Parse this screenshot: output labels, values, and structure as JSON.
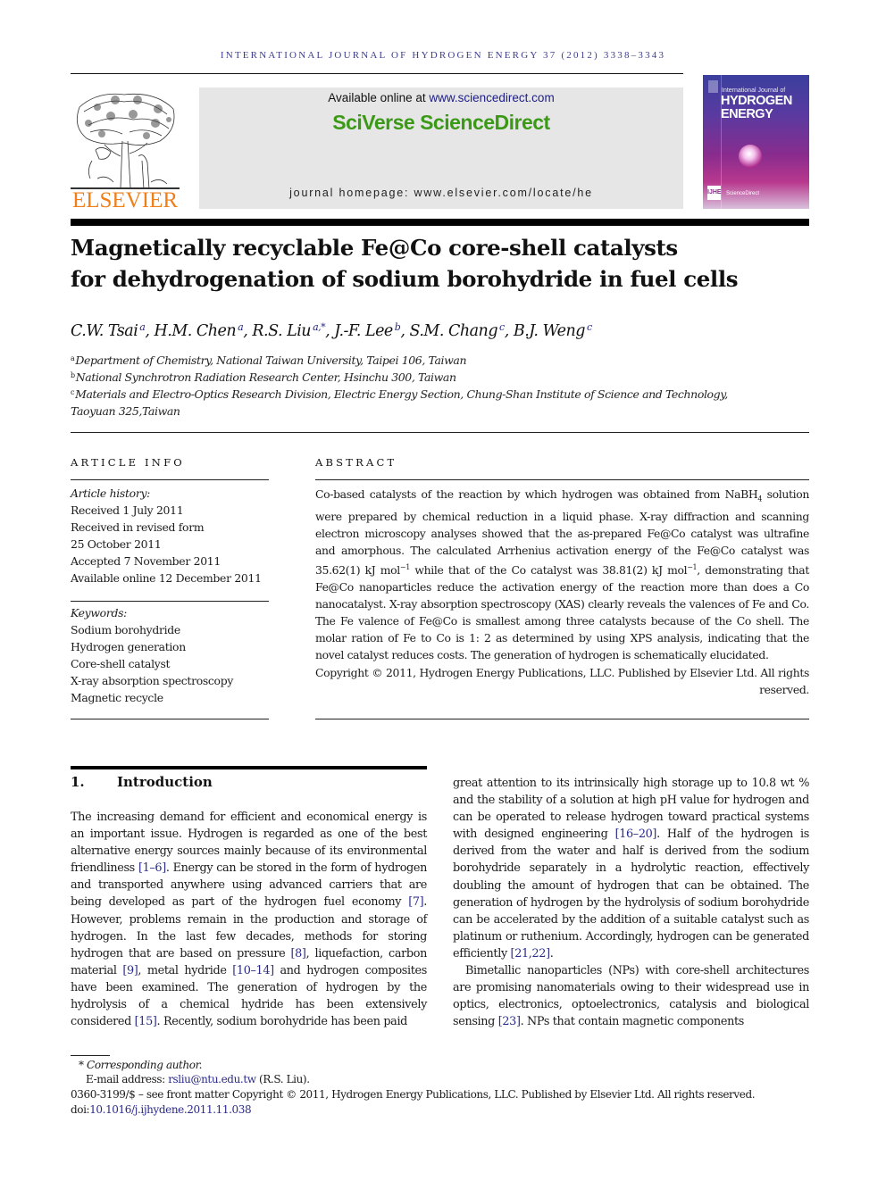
{
  "running_header": "INTERNATIONAL JOURNAL OF HYDROGEN ENERGY 37 (2012) 3338–3343",
  "publisher": {
    "logo_word": "ELSEVIER",
    "logo_color": "#f07f1a"
  },
  "banner": {
    "available_prefix": "Available online at ",
    "available_link": "www.sciencedirect.com",
    "brand": "SciVerse ScienceDirect",
    "brand_color": "#3a9a16",
    "homepage": "journal homepage: www.elsevier.com/locate/he"
  },
  "cover": {
    "line1": "International Journal of",
    "line2": "HYDROGEN",
    "line3": "ENERGY",
    "badge": "IJHE",
    "footer": "ScienceDirect"
  },
  "article": {
    "title_line1": "Magnetically recyclable Fe@Co core-shell catalysts",
    "title_line2": "for dehydrogenation of sodium borohydride in fuel cells",
    "authors": [
      {
        "name": "C.W. Tsai",
        "sup": "a"
      },
      {
        "name": "H.M. Chen",
        "sup": "a"
      },
      {
        "name": "R.S. Liu",
        "sup": "a,*"
      },
      {
        "name": "J.-F. Lee",
        "sup": "b"
      },
      {
        "name": "S.M. Chang",
        "sup": "c"
      },
      {
        "name": "B.J. Weng",
        "sup": "c"
      }
    ],
    "affiliations": [
      {
        "mark": "a",
        "text": "Department of Chemistry, National Taiwan University, Taipei 106, Taiwan"
      },
      {
        "mark": "b",
        "text": "National Synchrotron Radiation Research Center, Hsinchu 300, Taiwan"
      },
      {
        "mark": "c",
        "text": "Materials and Electro-Optics Research Division, Electric Energy Section, Chung-Shan Institute of Science and Technology,"
      },
      {
        "mark": "",
        "text": "Taoyuan 325,Taiwan"
      }
    ]
  },
  "article_info": {
    "heading": "ARTICLE INFO",
    "history_label": "Article history:",
    "history": [
      "Received 1 July 2011",
      "Received in revised form",
      "25 October 2011",
      "Accepted 7 November 2011",
      "Available online 12 December 2011"
    ],
    "keywords_label": "Keywords:",
    "keywords": [
      "Sodium borohydride",
      "Hydrogen generation",
      "Core-shell catalyst",
      "X-ray absorption spectroscopy",
      "Magnetic recycle"
    ]
  },
  "abstract": {
    "heading": "ABSTRACT",
    "p1_a": "Co-based catalysts of the reaction by which hydrogen was obtained from NaBH",
    "p1_sub": "4",
    "p1_b": " solution were prepared by chemical reduction in a liquid phase. X-ray diffraction and scanning electron microscopy analyses showed that the as-prepared Fe@Co catalyst was ultrafine and amorphous. The calculated Arrhenius activation energy of the Fe@Co catalyst was 35.62(1) kJ mol",
    "p1_sup1": "−1",
    "p1_c": " while that of the Co catalyst was 38.81(2) kJ mol",
    "p1_sup2": "−1",
    "p1_d": ", demonstrating that Fe@Co nanoparticles reduce the activation energy of the reaction more than does a Co nanocatalyst. X-ray absorption spectroscopy (XAS) clearly reveals the valences of Fe and Co. The Fe valence of Fe@Co is smallest among three catalysts because of the Co shell. The molar ration of Fe to Co is 1: 2 as determined by using XPS analysis, indicating that the novel catalyst reduces costs. The generation of hydrogen is schematically elucidated.",
    "copyright": "Copyright © 2011, Hydrogen Energy Publications, LLC. Published by Elsevier Ltd. All rights reserved."
  },
  "introduction": {
    "number": "1.",
    "title": "Introduction",
    "left": [
      {
        "t": "The increasing demand for efficient and economical energy is an important issue. Hydrogen is regarded as one of the best alternative energy sources mainly because of its environ­mental friendliness "
      },
      {
        "ref": "[1–6]"
      },
      {
        "t": ". Energy can be stored in the form of hydrogen and transported anywhere using advanced carriers that are being developed as part of the hydrogen fuel economy "
      },
      {
        "ref": "[7]"
      },
      {
        "t": ". However, problems remain in the production and storage of hydrogen. In the last few decades, methods for storing hydrogen that are based on pressure "
      },
      {
        "ref": "[8]"
      },
      {
        "t": ", liquefaction, carbon material "
      },
      {
        "ref": "[9]"
      },
      {
        "t": ", metal hydride "
      },
      {
        "ref": "[10–14]"
      },
      {
        "t": " and hydrogen composites have been examined. The generation of hydrogen by the hydrolysis of a chemical hydride has been extensively considered "
      },
      {
        "ref": "[15]"
      },
      {
        "t": ". Recently, sodium borohydride has been paid"
      }
    ],
    "right_p1": [
      {
        "t": "great attention to its intrinsically high storage up to 10.8 wt % and the stability of a solution at high pH value for hydrogen and can be operated to release hydrogen toward practical systems with designed engineering "
      },
      {
        "ref": "[16–20]"
      },
      {
        "t": ". Half of the hydrogen is derived from the water and half is derived from the sodium borohydride separately in a hydrolytic reaction, effectively doubling the amount of hydrogen that can be ob­tained. The generation of hydrogen by the hydrolysis of sodium borohydride can be accelerated by the addition of a suitable catalyst such as platinum or ruthenium. Accord­ingly, hydrogen can be generated efficiently "
      },
      {
        "ref": "[21,22]"
      },
      {
        "t": "."
      }
    ],
    "right_p2": [
      {
        "t": "Bimetallic nanoparticles (NPs) with core-shell architec­tures are promising nanomaterials owing to their widespread use in optics, electronics, optoelectronics, catalysis and bio­logical sensing "
      },
      {
        "ref": "[23]"
      },
      {
        "t": ". NPs that contain magnetic components"
      }
    ]
  },
  "footnotes": {
    "corresponding_mark": "*",
    "corresponding": "Corresponding author.",
    "email_label": "E-mail address: ",
    "email": "rsliu@ntu.edu.tw",
    "email_suffix": " (R.S. Liu).",
    "issn_line": "0360-3199/$ – see front matter Copyright © 2011, Hydrogen Energy Publications, LLC. Published by Elsevier Ltd. All rights reserved.",
    "doi_label": "doi:",
    "doi": "10.1016/j.ijhydene.2011.11.038"
  }
}
